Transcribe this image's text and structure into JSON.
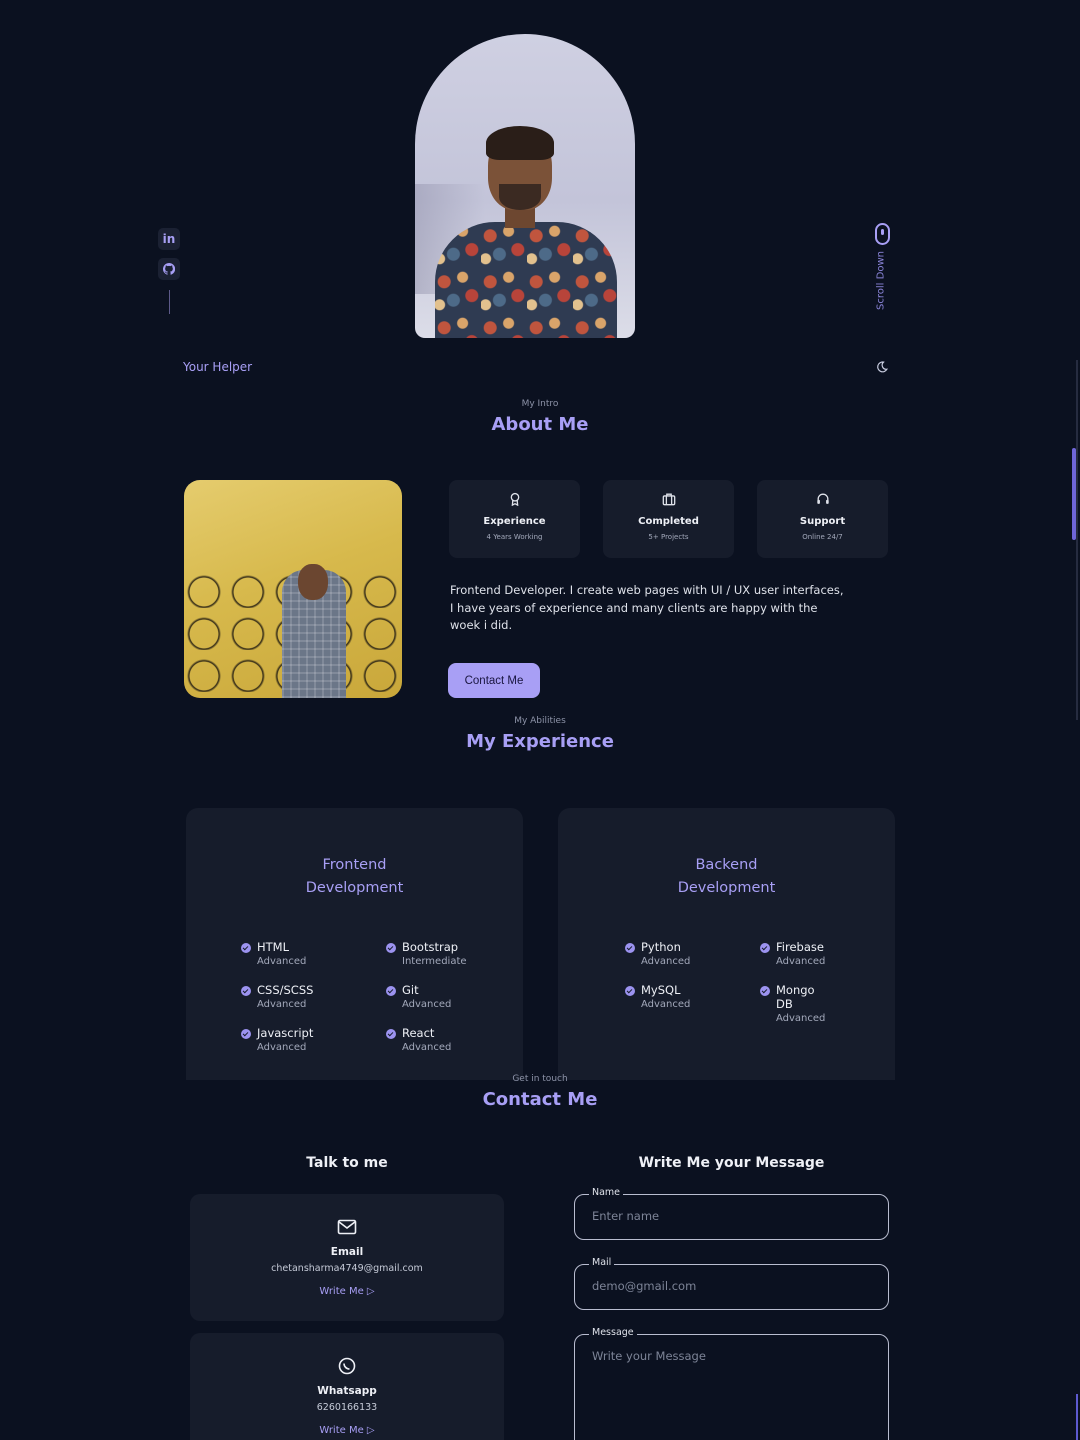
{
  "hero": {
    "social": [
      "in",
      "github-icon"
    ],
    "scroll_text": "Scroll Down"
  },
  "nav": {
    "logo": "Your Helper"
  },
  "about": {
    "subtitle": "My Intro",
    "title": "About Me",
    "stats": [
      {
        "icon": "award-icon",
        "title": "Experience",
        "sub": "4 Years Working"
      },
      {
        "icon": "briefcase-icon",
        "title": "Completed",
        "sub": "5+ Projects"
      },
      {
        "icon": "headset-icon",
        "title": "Support",
        "sub": "Online 24/7"
      }
    ],
    "description": "Frontend Developer. I create web pages with UI / UX user interfaces, I have years of experience and many clients are happy with the woek i did.",
    "button": "Contact Me"
  },
  "experience": {
    "subtitle": "My Abilities",
    "title": "My Experience",
    "cards": [
      {
        "title_line1": "Frontend",
        "title_line2": "Development",
        "skills": [
          {
            "name": "HTML",
            "level": "Advanced"
          },
          {
            "name": "Bootstrap",
            "level": "Intermediate"
          },
          {
            "name": "CSS/SCSS",
            "level": "Advanced"
          },
          {
            "name": "Git",
            "level": "Advanced"
          },
          {
            "name": "Javascript",
            "level": "Advanced"
          },
          {
            "name": "React",
            "level": "Advanced"
          }
        ]
      },
      {
        "title_line1": "Backend",
        "title_line2": "Development",
        "skills": [
          {
            "name": "Python",
            "level": "Advanced"
          },
          {
            "name": "Firebase",
            "level": "Advanced"
          },
          {
            "name": "MySQL",
            "level": "Advanced"
          },
          {
            "name": "Mongo DB",
            "level": "Advanced"
          }
        ]
      }
    ]
  },
  "contact": {
    "subtitle": "Get in touch",
    "title": "Contact Me",
    "talk_title": "Talk to me",
    "form_title": "Write Me your Message",
    "cards": [
      {
        "icon": "mail-icon",
        "title": "Email",
        "value": "chetansharma4749@gmail.com",
        "link": "Write Me ▷"
      },
      {
        "icon": "whatsapp-icon",
        "title": "Whatsapp",
        "value": "6260166133",
        "link": "Write Me ▷"
      }
    ],
    "form": {
      "name_label": "Name",
      "name_placeholder": "Enter name",
      "mail_label": "Mail",
      "mail_placeholder": "demo@gmail.com",
      "message_label": "Message",
      "message_placeholder": "Write your Message"
    }
  },
  "colors": {
    "accent": "#a89ff5",
    "background": "#0b1120",
    "card": "#161c2b"
  }
}
